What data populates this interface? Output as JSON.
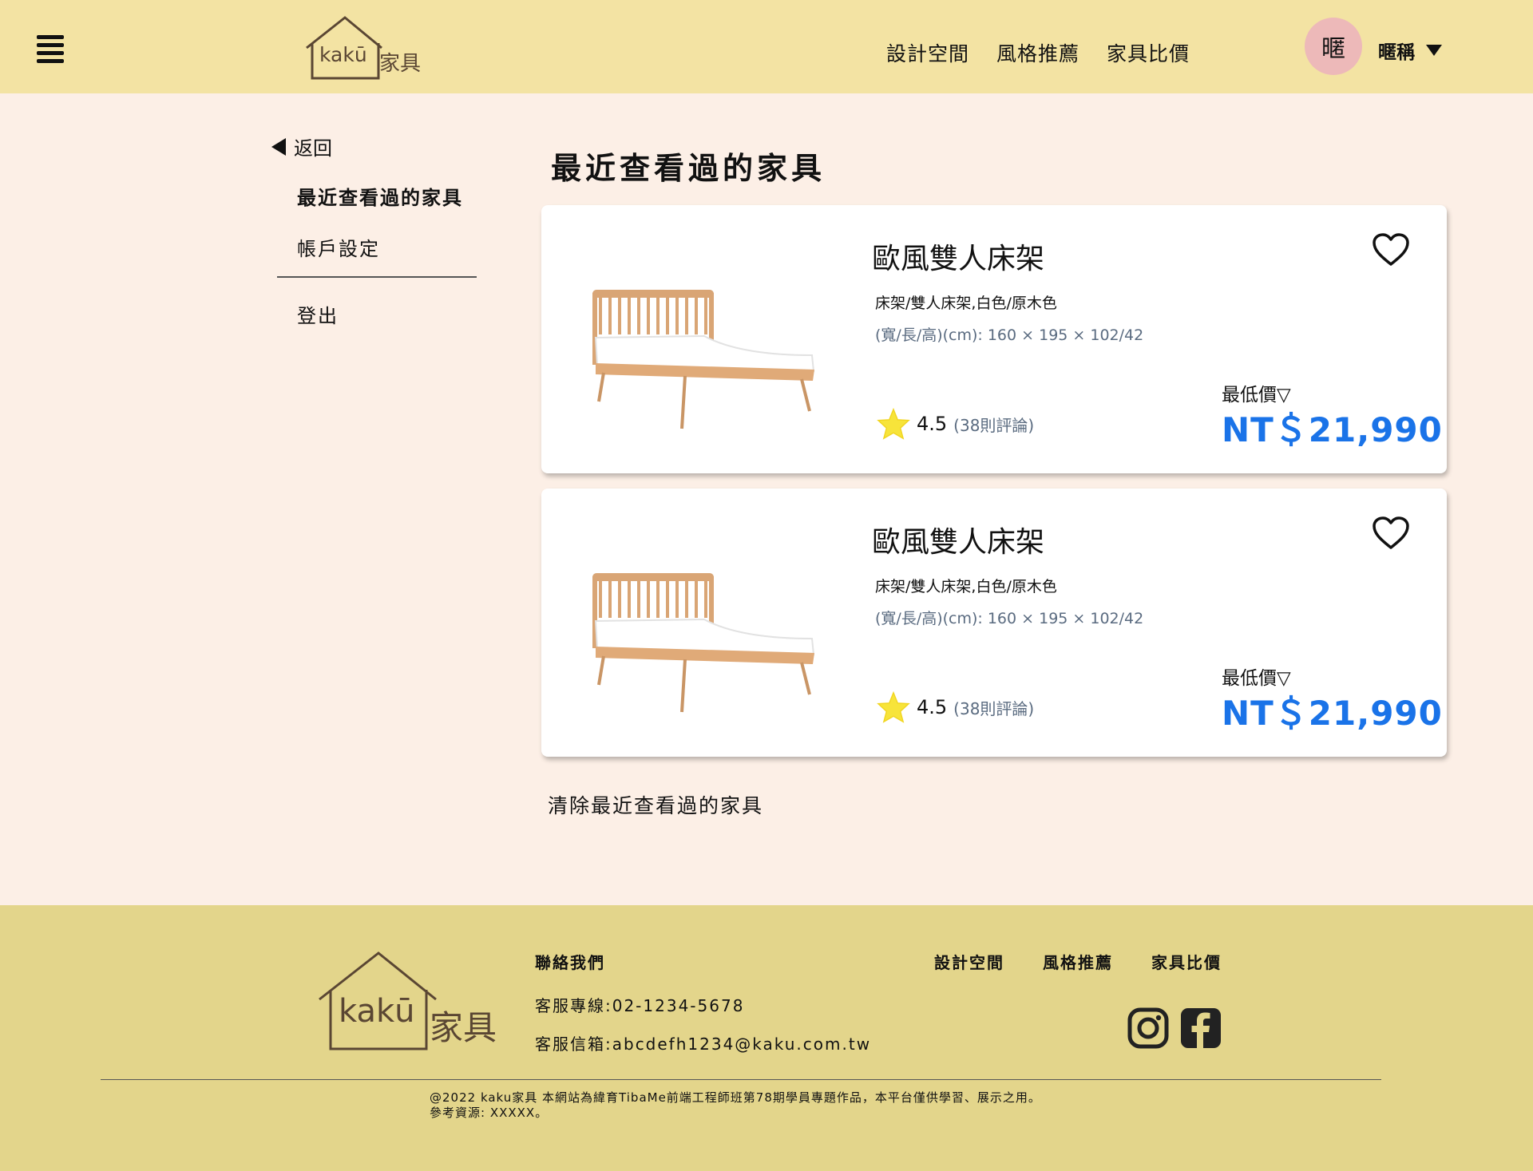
{
  "header": {
    "logo_text": "kakū",
    "logo_text_cn": "家具",
    "nav": [
      "設計空間",
      "風格推薦",
      "家具比價"
    ],
    "avatar_char": "暱",
    "username": "暱稱"
  },
  "sidebar": {
    "back_label": "返回",
    "items": [
      "最近查看過的家具",
      "帳戶設定",
      "登出"
    ]
  },
  "main": {
    "title": "最近查看過的家具",
    "products": [
      {
        "name": "歐風雙人床架",
        "category": "床架/雙人床架,白色/原木色",
        "dimensions": "(寬/長/高)(cm): 160 × 195 × 102/42",
        "rating": "4.5",
        "reviews": "(38則評論)",
        "price_label": "最低價▽",
        "price": "NT＄21,990"
      },
      {
        "name": "歐風雙人床架",
        "category": "床架/雙人床架,白色/原木色",
        "dimensions": "(寬/長/高)(cm): 160 × 195 × 102/42",
        "rating": "4.5",
        "reviews": "(38則評論)",
        "price_label": "最低價▽",
        "price": "NT＄21,990"
      }
    ],
    "clear_label": "清除最近查看過的家具"
  },
  "footer": {
    "contact_title": "聯絡我們",
    "phone": "客服專線:02-1234-5678",
    "email": "客服信箱:abcdefh1234@kaku.com.tw",
    "nav": [
      "設計空間",
      "風格推薦",
      "家具比價"
    ],
    "copyright_line1": "@2022 kaku家具 本網站為緯育TibaMe前端工程師班第78期學員專題作品，本平台僅供學習、展示之用。",
    "copyright_line2": "參考資源: XXXXX。"
  },
  "colors": {
    "header_bg": "#f3e3a3",
    "page_bg": "#fcefe6",
    "footer_bg": "#e3d58b",
    "price_blue": "#1a73e8",
    "avatar_bg": "#edb9b9",
    "logo_brown": "#5a4633"
  },
  "icons": {
    "menu": "hamburger-icon",
    "back": "triangle-left-icon",
    "dropdown": "triangle-down-icon",
    "favorite": "heart-icon",
    "rating": "star-icon",
    "instagram": "instagram-icon",
    "facebook": "facebook-icon"
  }
}
